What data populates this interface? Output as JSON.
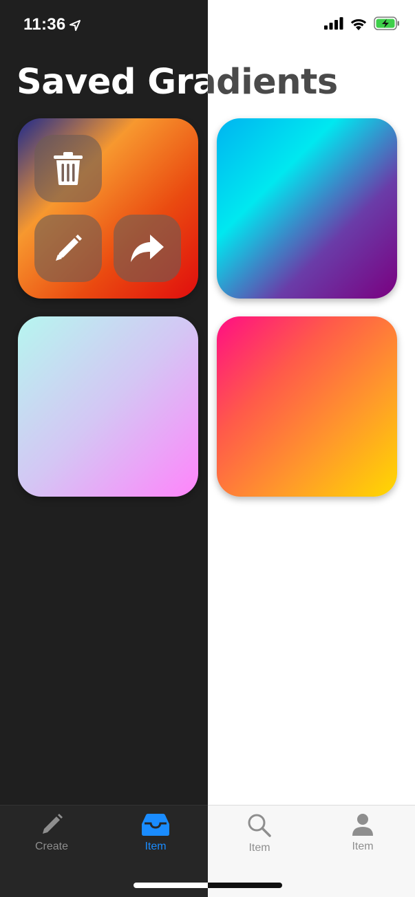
{
  "status_bar": {
    "time": "11:36"
  },
  "page": {
    "title": "Saved Gradients"
  },
  "tiles": [
    {
      "name": "gradient-1",
      "colors": [
        "#1f2a8c",
        "#f7982f",
        "#ea4a10",
        "#e00d0d"
      ]
    },
    {
      "name": "gradient-2",
      "colors": [
        "#00b4f0",
        "#00e8f0",
        "#6a3ca8",
        "#7a0080"
      ]
    },
    {
      "name": "gradient-3",
      "colors": [
        "#b6f6ef",
        "#d4c6f4",
        "#ff84fb"
      ]
    },
    {
      "name": "gradient-4",
      "colors": [
        "#ff0e84",
        "#ff5a4a",
        "#ff9a2a",
        "#ffd900"
      ]
    }
  ],
  "tile_actions": {
    "delete_icon": "trash-icon",
    "edit_icon": "pencil-icon",
    "share_icon": "share-arrow-icon"
  },
  "tabbar": {
    "items": [
      {
        "label": "Create",
        "icon": "pencil-icon",
        "active": false
      },
      {
        "label": "Item",
        "icon": "inbox-tray-icon",
        "active": true
      },
      {
        "label": "Item",
        "icon": "search-icon",
        "active": false
      },
      {
        "label": "Item",
        "icon": "person-icon",
        "active": false
      }
    ],
    "active_color": "#1a8cff",
    "inactive_color": "#8e8e8e"
  }
}
